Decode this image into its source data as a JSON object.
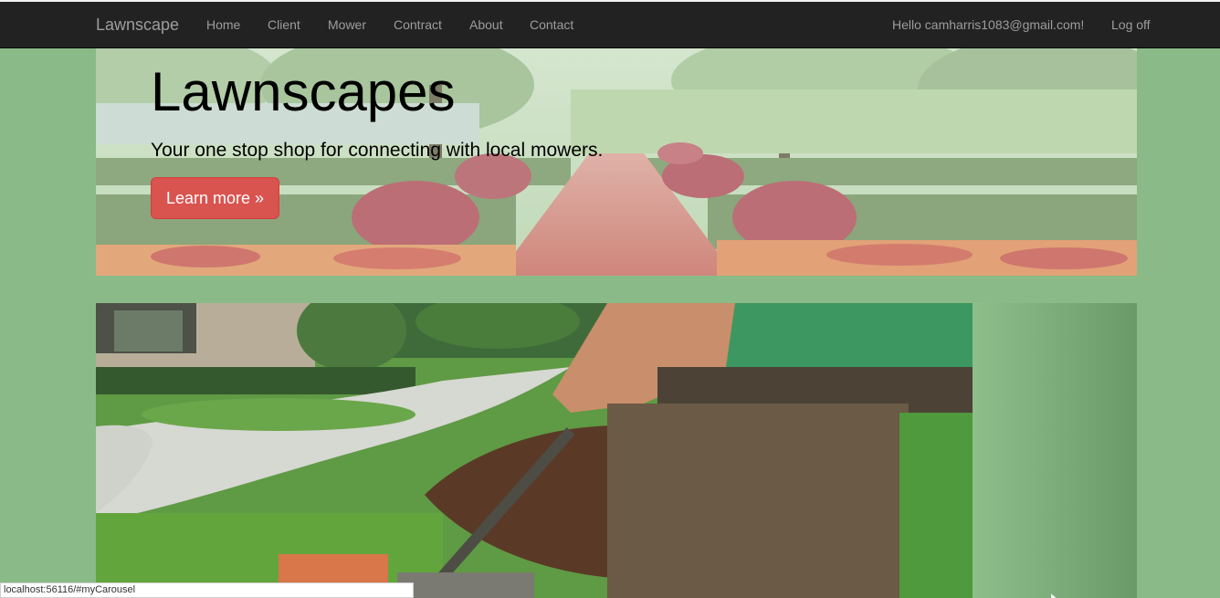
{
  "navbar": {
    "brand": "Lawnscape",
    "links": [
      "Home",
      "Client",
      "Mower",
      "Contract",
      "About",
      "Contact"
    ],
    "greeting": "Hello camharris1083@gmail.com!",
    "logoff": "Log off"
  },
  "jumbotron": {
    "title": "Lawnscapes",
    "lead": "Your one stop shop for connecting with local mowers.",
    "button": "Learn more »"
  },
  "carousel": {
    "next_glyph": "›"
  },
  "status": {
    "url": "localhost:56116/#myCarousel"
  },
  "colors": {
    "page_background": "#8aba87",
    "navbar": "#222222",
    "button": "#d9534f"
  }
}
